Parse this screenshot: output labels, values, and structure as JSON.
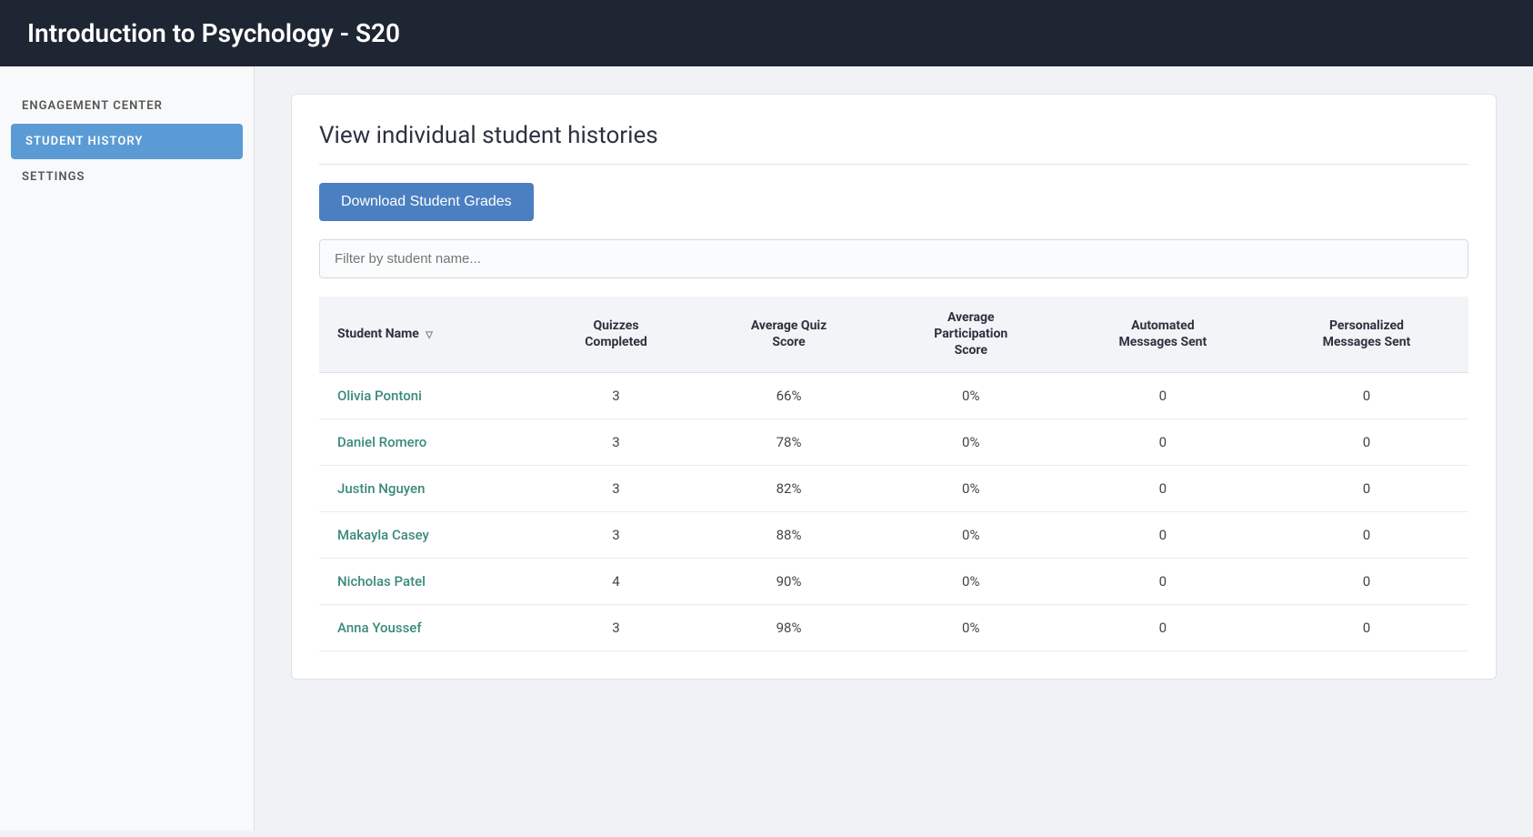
{
  "header": {
    "title": "Introduction to Psychology - S20"
  },
  "sidebar": {
    "items": [
      {
        "id": "engagement-center",
        "label": "ENGAGEMENT CENTER",
        "active": false
      },
      {
        "id": "student-history",
        "label": "STUDENT HISTORY",
        "active": true
      },
      {
        "id": "settings",
        "label": "SETTINGS",
        "active": false
      }
    ]
  },
  "main": {
    "page_title": "View individual student histories",
    "download_button_label": "Download Student Grades",
    "filter_placeholder": "Filter by student name...",
    "table": {
      "columns": [
        {
          "id": "name",
          "label": "Student Name",
          "sortable": true
        },
        {
          "id": "quizzes",
          "label": "Quizzes\nCompleted",
          "sortable": false
        },
        {
          "id": "avg_quiz",
          "label": "Average Quiz\nScore",
          "sortable": false
        },
        {
          "id": "avg_participation",
          "label": "Average\nParticipation\nScore",
          "sortable": false
        },
        {
          "id": "automated_msg",
          "label": "Automated\nMessages Sent",
          "sortable": false
        },
        {
          "id": "personalized_msg",
          "label": "Personalized\nMessages Sent",
          "sortable": false
        }
      ],
      "rows": [
        {
          "name": "Olivia Pontoni",
          "quizzes": "3",
          "avg_quiz": "66%",
          "avg_participation": "0%",
          "automated_msg": "0",
          "personalized_msg": "0"
        },
        {
          "name": "Daniel Romero",
          "quizzes": "3",
          "avg_quiz": "78%",
          "avg_participation": "0%",
          "automated_msg": "0",
          "personalized_msg": "0"
        },
        {
          "name": "Justin Nguyen",
          "quizzes": "3",
          "avg_quiz": "82%",
          "avg_participation": "0%",
          "automated_msg": "0",
          "personalized_msg": "0"
        },
        {
          "name": "Makayla Casey",
          "quizzes": "3",
          "avg_quiz": "88%",
          "avg_participation": "0%",
          "automated_msg": "0",
          "personalized_msg": "0"
        },
        {
          "name": "Nicholas Patel",
          "quizzes": "4",
          "avg_quiz": "90%",
          "avg_participation": "0%",
          "automated_msg": "0",
          "personalized_msg": "0"
        },
        {
          "name": "Anna Youssef",
          "quizzes": "3",
          "avg_quiz": "98%",
          "avg_participation": "0%",
          "automated_msg": "0",
          "personalized_msg": "0"
        }
      ]
    }
  },
  "colors": {
    "header_bg": "#1e2533",
    "sidebar_active_bg": "#5b9bd5",
    "download_btn_bg": "#4a7fc1",
    "student_link_color": "#3b8a7a"
  }
}
